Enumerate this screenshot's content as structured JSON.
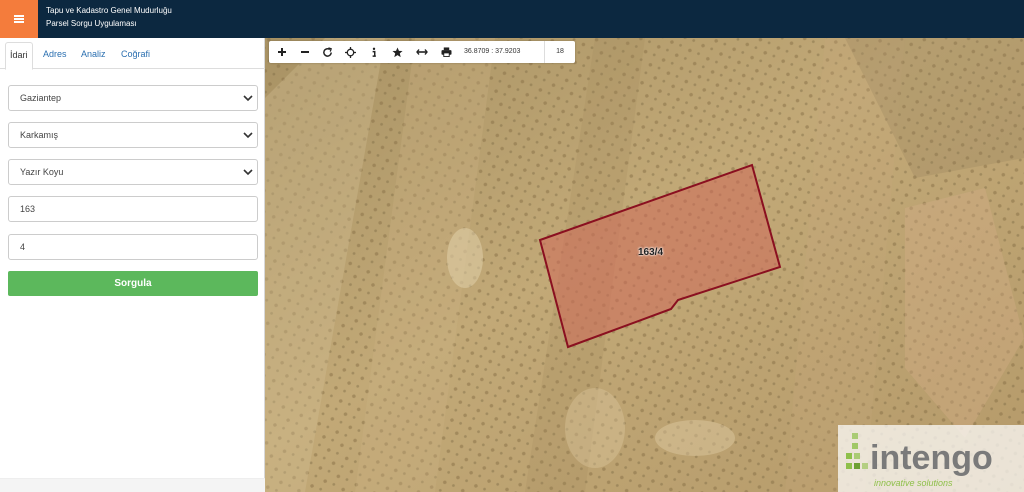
{
  "header": {
    "title_line1": "Tapu ve Kadastro Genel Mudurluğu",
    "title_line2": "Parsel Sorgu Uygulaması",
    "menu_icon": "hamburger-icon",
    "menu_color": "#f47c3c",
    "bg_color": "#0c2840"
  },
  "sidebar": {
    "tabs": [
      {
        "label": "İdari",
        "active": true
      },
      {
        "label": "Adres",
        "active": false
      },
      {
        "label": "Analiz",
        "active": false
      },
      {
        "label": "Coğrafi",
        "active": false
      }
    ],
    "form": {
      "il": "Gaziantep",
      "ilce": "Karkamış",
      "mahalle": "Yazır Koyu",
      "ada": "163",
      "parsel": "4"
    },
    "submit_label": "Sorgula",
    "submit_color": "#5cb85c"
  },
  "map": {
    "toolbar": {
      "icons": [
        "plus-icon",
        "minus-icon",
        "refresh-icon",
        "locate-icon",
        "info-icon",
        "star-icon",
        "measure-icon",
        "print-icon"
      ],
      "coordinates": "36.8709 : 37.9203",
      "zoom": "18"
    },
    "parcel": {
      "label": "163/4",
      "fill_color": "#d06a5a",
      "stroke_color": "#8a1020"
    },
    "logo": {
      "word": "intengo",
      "tagline": "innovative solutions"
    }
  }
}
